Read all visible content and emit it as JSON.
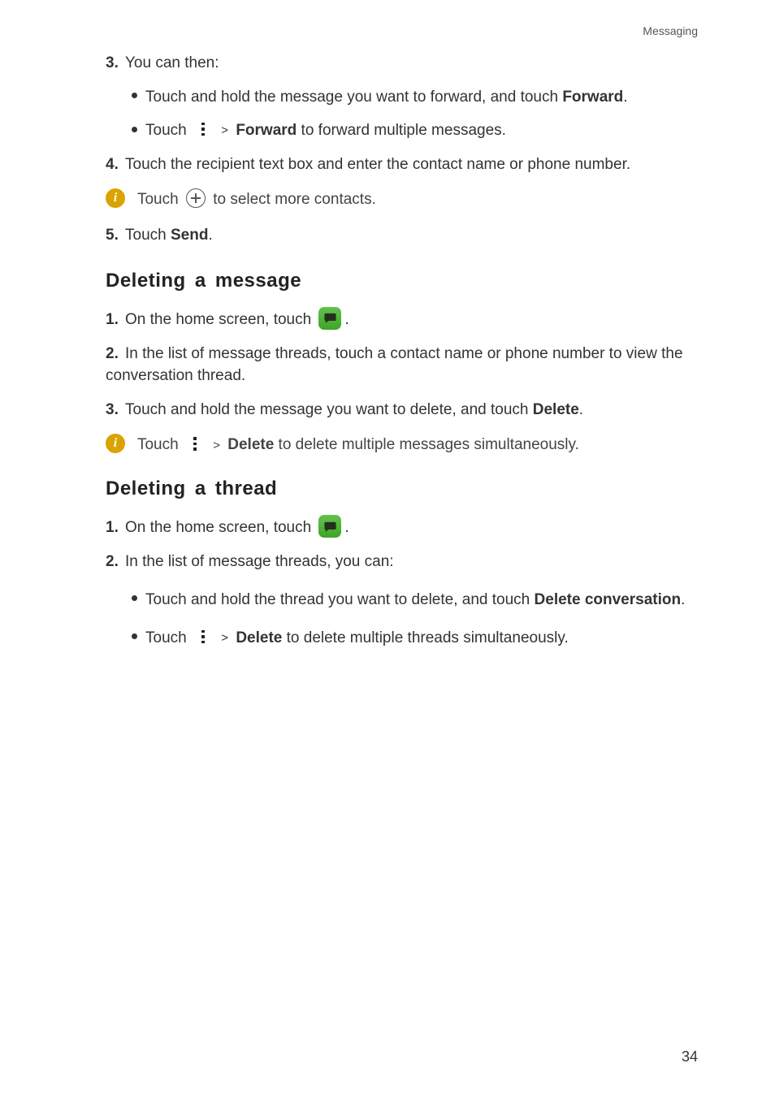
{
  "running_head": "Messaging",
  "page_number": "34",
  "steps": {
    "s3": {
      "num": "3.",
      "text": "You can then:"
    },
    "s3b1a": "Touch and hold the message you want to forward, and touch ",
    "s3b1b": "Forward",
    "s3b1c": ".",
    "s3b2a": "Touch ",
    "s3b2b": "Forward",
    "s3b2c": " to forward multiple messages.",
    "s4": {
      "num": "4.",
      "text": "Touch the recipient text box and enter the contact name or phone number."
    },
    "note1a": "Touch ",
    "note1b": "to select more contacts.",
    "s5": {
      "num": "5.",
      "texta": "Touch ",
      "textb": "Send",
      "textc": "."
    }
  },
  "section1": {
    "title": "Deleting a message",
    "s1": {
      "num": "1.",
      "texta": "On the home screen, touch ",
      "textb": "."
    },
    "s2": {
      "num": "2.",
      "text": "In the list of message threads, touch a contact name or phone number to view the conversation thread."
    },
    "s3": {
      "num": "3.",
      "texta": "Touch and hold the message you want to delete, and touch ",
      "textb": "Delete",
      "textc": "."
    },
    "note": {
      "a": "Touch ",
      "b": "Delete",
      "c": " to delete multiple messages simultaneously."
    }
  },
  "section2": {
    "title": "Deleting a thread",
    "s1": {
      "num": "1.",
      "texta": "On the home screen, touch ",
      "textb": "."
    },
    "s2": {
      "num": "2.",
      "text": "In the list of message threads, you can:"
    },
    "b1": {
      "a": "Touch and hold the thread you want to delete, and touch ",
      "b": "Delete conversation",
      "c": "."
    },
    "b2": {
      "a": "Touch ",
      "b": "Delete",
      "c": " to delete multiple threads simultaneously."
    }
  },
  "gt": ">"
}
